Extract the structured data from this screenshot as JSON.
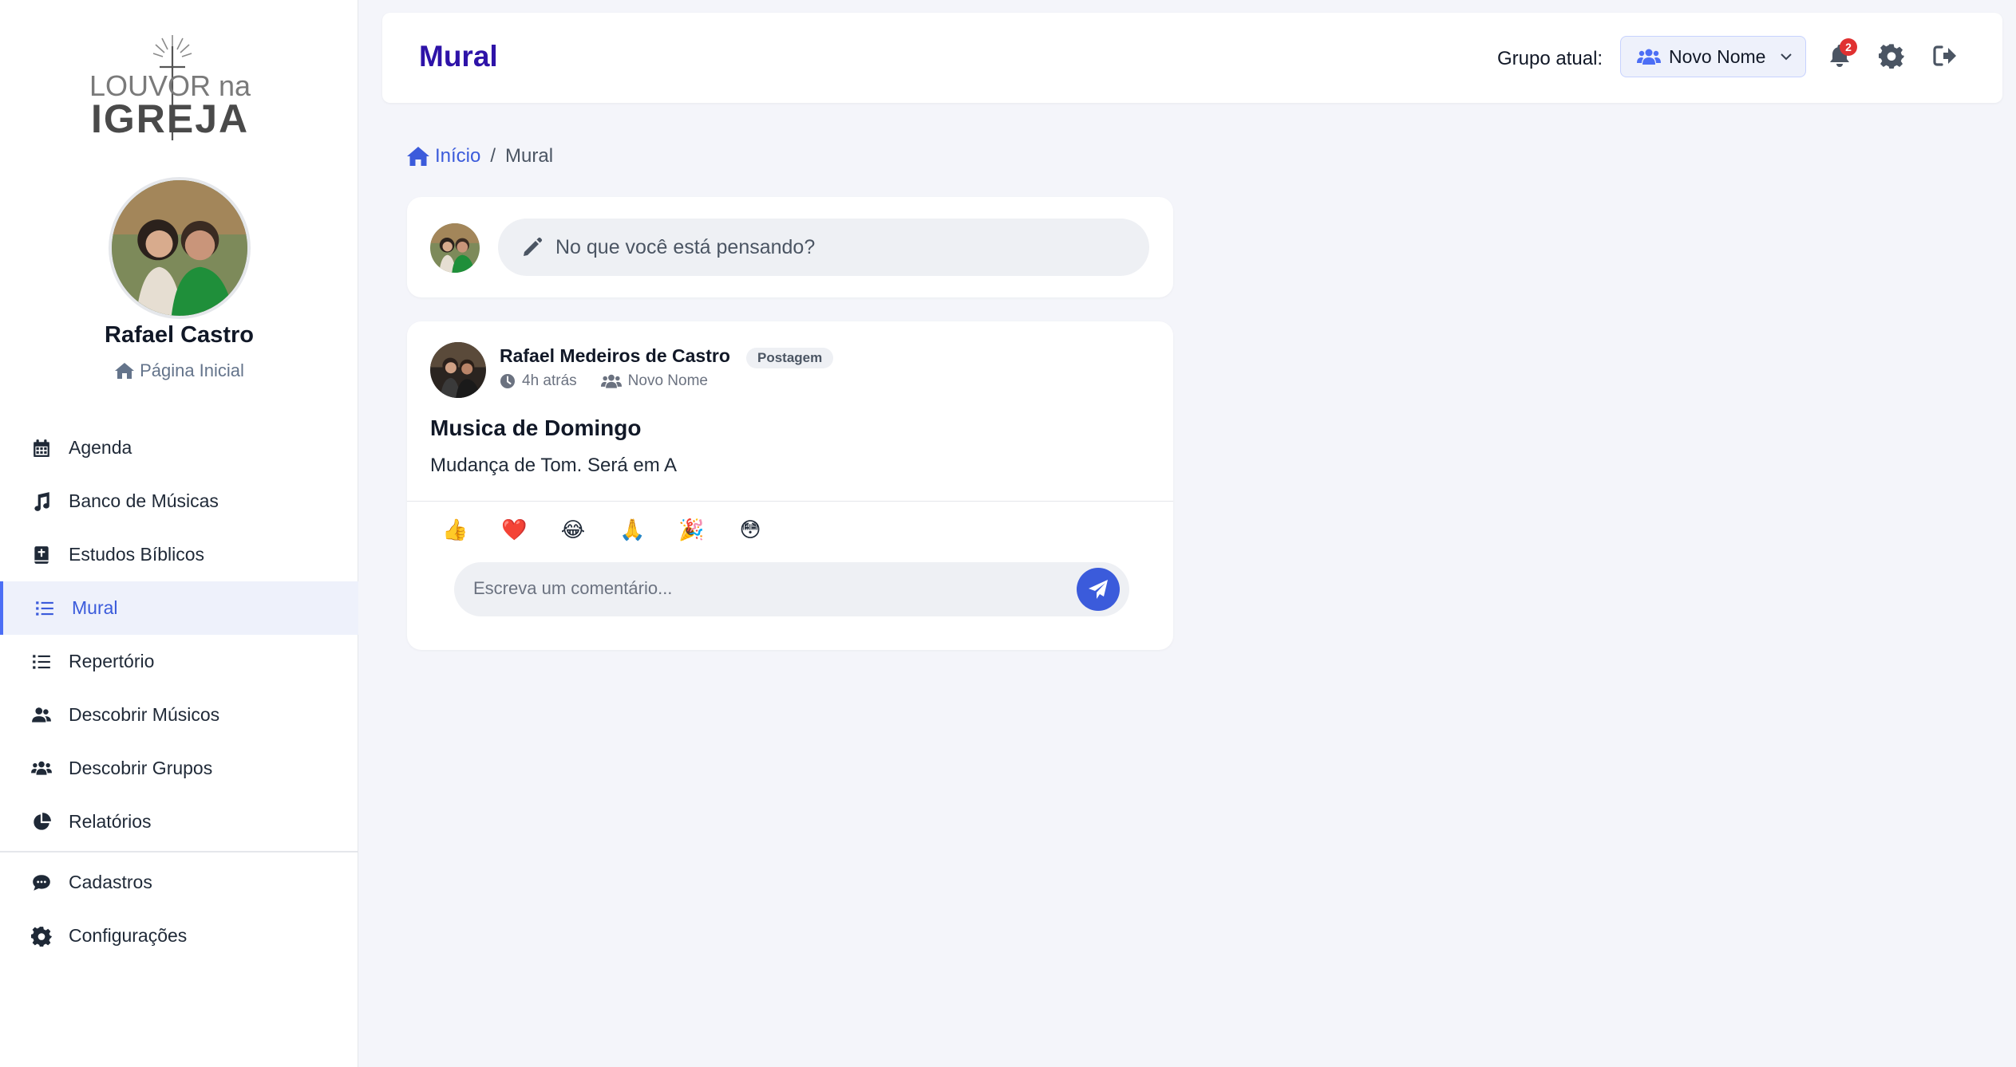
{
  "brand": {
    "logo_line1": "LOUVOR na",
    "logo_line2": "IGREJA"
  },
  "user": {
    "name": "Rafael Castro",
    "home_link": "Página Inicial"
  },
  "sidebar": {
    "items": [
      {
        "label": "Agenda",
        "icon": "calendar-icon"
      },
      {
        "label": "Banco de Músicas",
        "icon": "music-note-icon"
      },
      {
        "label": "Estudos Bíblicos",
        "icon": "bible-icon"
      },
      {
        "label": "Mural",
        "icon": "list-icon",
        "active": true
      },
      {
        "label": "Repertório",
        "icon": "list-icon"
      },
      {
        "label": "Descobrir Músicos",
        "icon": "users-icon"
      },
      {
        "label": "Descobrir Grupos",
        "icon": "group-icon"
      },
      {
        "label": "Relatórios",
        "icon": "pie-chart-icon"
      }
    ],
    "secondary_items": [
      {
        "label": "Cadastros",
        "icon": "chat-bubble-icon"
      },
      {
        "label": "Configurações",
        "icon": "gear-icon"
      }
    ]
  },
  "header": {
    "title": "Mural",
    "group_label": "Grupo atual:",
    "group_value": "Novo Nome",
    "notification_count": "2"
  },
  "breadcrumb": {
    "home": "Início",
    "separator": "/",
    "current": "Mural"
  },
  "composer": {
    "placeholder": "No que você está pensando?"
  },
  "post": {
    "author": "Rafael Medeiros de Castro",
    "tag": "Postagem",
    "time": "4h atrás",
    "group": "Novo Nome",
    "title": "Musica de Domingo",
    "body": "Mudança de Tom. Será em A",
    "reactions": [
      "👍",
      "❤️",
      "😂",
      "🙏",
      "🎉",
      "😳"
    ],
    "comment_placeholder": "Escreva um comentário..."
  },
  "colors": {
    "accent": "#3b5bdb",
    "title": "#2e13a8",
    "badge": "#e03131",
    "background": "#f4f5fa"
  }
}
